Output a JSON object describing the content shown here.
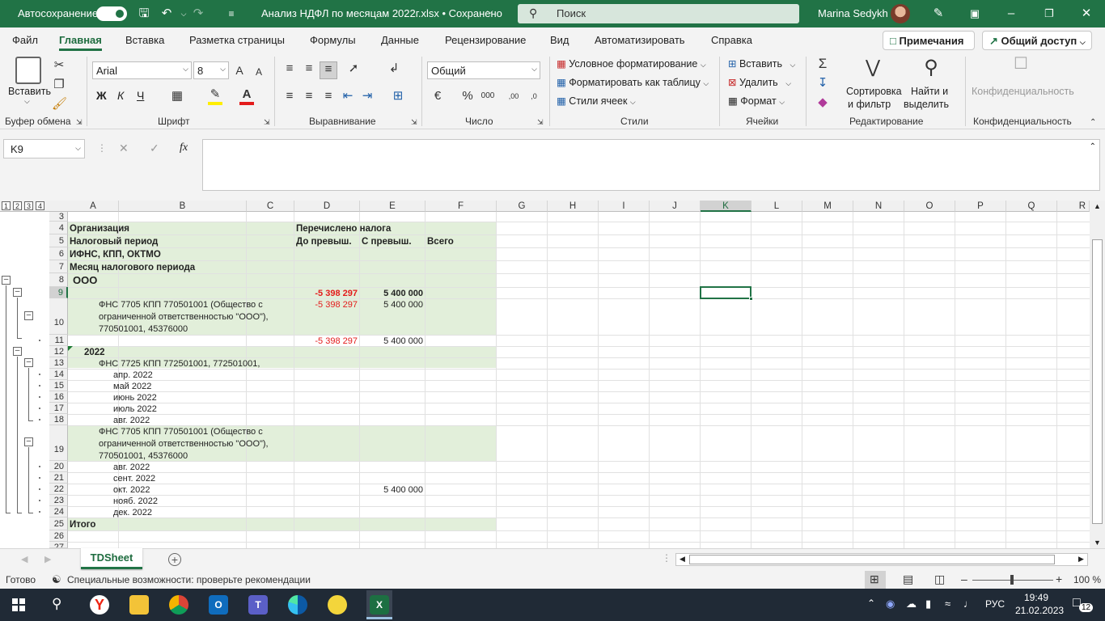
{
  "titlebar": {
    "autosave": "Автосохранение",
    "filename": "Анализ НДФЛ по месяцам 2022г.xlsx • Сохранено",
    "search": "Поиск",
    "user": "Marina Sedykh"
  },
  "menu": {
    "tabs": [
      "Файл",
      "Главная",
      "Вставка",
      "Разметка страницы",
      "Формулы",
      "Данные",
      "Рецензирование",
      "Вид",
      "Автоматизировать",
      "Справка"
    ],
    "comments": "Примечания",
    "share": "Общий доступ"
  },
  "ribbon": {
    "clipboard": {
      "paste": "Вставить",
      "group": "Буфер обмена"
    },
    "font": {
      "name": "Arial",
      "size": "8",
      "group": "Шрифт",
      "bold": "Ж",
      "italic": "К",
      "underline": "Ч"
    },
    "align": {
      "group": "Выравнивание"
    },
    "number": {
      "format": "Общий",
      "group": "Число"
    },
    "styles": {
      "cond": "Условное форматирование",
      "table": "Форматировать как таблицу",
      "cell": "Стили ячеек",
      "group": "Стили"
    },
    "cells": {
      "insert": "Вставить",
      "delete": "Удалить",
      "format": "Формат",
      "group": "Ячейки"
    },
    "edit": {
      "sort1": "Сортировка",
      "sort2": "и фильтр",
      "find1": "Найти и",
      "find2": "выделить",
      "group": "Редактирование"
    },
    "conf": {
      "label": "Конфиденциальность",
      "group": "Конфиденциальность"
    }
  },
  "formula": {
    "namebox": "K9",
    "fx": "fx",
    "value": ""
  },
  "outline_levels": [
    "1",
    "2",
    "3",
    "4"
  ],
  "columns": [
    "A",
    "B",
    "C",
    "D",
    "E",
    "F",
    "G",
    "H",
    "I",
    "J",
    "K",
    "L",
    "M",
    "N",
    "O",
    "P",
    "Q",
    "R"
  ],
  "rows": {
    "r4a": "Организация",
    "r4d": "Перечислено налога",
    "r5a": "Налоговый период",
    "r5d": "До превыш.",
    "r5e": "С превыш.",
    "r5f": "Всего",
    "r6a": "ИФНС, КПП, ОКТМО",
    "r7a": "Месяц налогового периода",
    "r8a": "ООО",
    "r9d": "-5 398 297",
    "r9e": "5 400 000",
    "r10b1": "ФНС 7705 КПП 770501001 (Общество с",
    "r10b2": "ограниченной ответственностью \"ООО\"),",
    "r10b3": "770501001, 45376000",
    "r10d": "-5 398 297",
    "r10e": "5 400 000",
    "r11d": "-5 398 297",
    "r11e": "5 400 000",
    "r12a": "2022",
    "r13b": "ФНС 7725 КПП 772501001, 772501001,",
    "r14b": "апр. 2022",
    "r15b": "май 2022",
    "r16b": "июнь 2022",
    "r17b": "июль 2022",
    "r18b": "авг. 2022",
    "r19b1": "ФНС 7705 КПП 770501001 (Общество с",
    "r19b2": "ограниченной ответственностью \"ООО\"),",
    "r19b3": "770501001, 45376000",
    "r20b": "авг. 2022",
    "r21b": "сент. 2022",
    "r22b": "окт. 2022",
    "r22e": "5 400 000",
    "r23b": "нояб. 2022",
    "r24b": "дек. 2022",
    "r25a": "Итого"
  },
  "row_numbers": [
    "3",
    "4",
    "5",
    "6",
    "7",
    "8",
    "9",
    "10",
    "11",
    "12",
    "13",
    "14",
    "15",
    "16",
    "17",
    "18",
    "19",
    "20",
    "21",
    "22",
    "23",
    "24",
    "25",
    "26",
    "27"
  ],
  "sheet": {
    "tab": "TDSheet"
  },
  "status": {
    "ready": "Готово",
    "access": "Специальные возможности: проверьте рекомендации",
    "zoom": "100 %"
  },
  "taskbar": {
    "lang": "РУС",
    "time": "19:49",
    "date": "21.02.2023",
    "notif": "12"
  },
  "colors": {
    "accent": "#217346",
    "fill": "#e2efda",
    "negative": "#e31b1b"
  }
}
